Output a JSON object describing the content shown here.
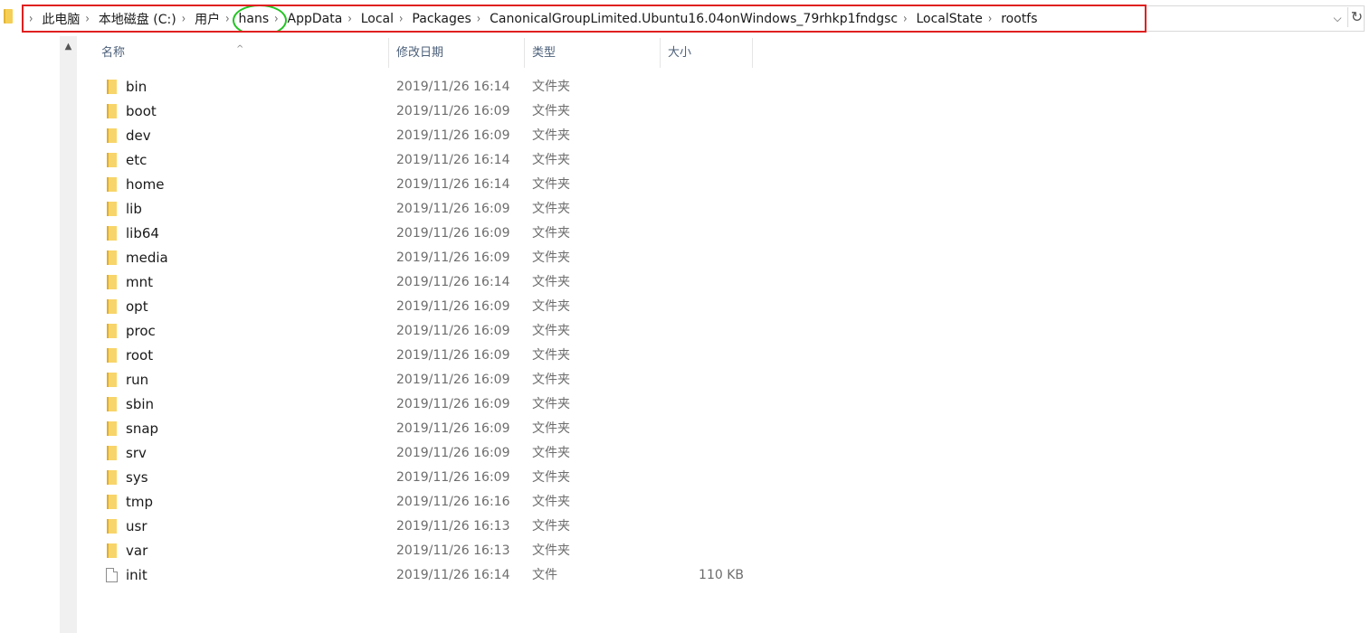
{
  "address_bar": {
    "breadcrumbs": [
      "此电脑",
      "本地磁盘 (C:)",
      "用户",
      "hans",
      "AppData",
      "Local",
      "Packages",
      "CanonicalGroupLimited.Ubuntu16.04onWindows_79rhkp1fndgsc",
      "LocalState",
      "rootfs"
    ],
    "separator_glyph": "›",
    "dropdown_glyph": "⌵",
    "refresh_glyph": "↻",
    "highlight_box_color": "#e02020",
    "highlight_ellipse_color": "#22c422"
  },
  "columns": {
    "name": "名称",
    "date": "修改日期",
    "type": "类型",
    "size": "大小"
  },
  "files": [
    {
      "name": "bin",
      "date": "2019/11/26 16:14",
      "type": "文件夹",
      "size": "",
      "icon": "folder-icon"
    },
    {
      "name": "boot",
      "date": "2019/11/26 16:09",
      "type": "文件夹",
      "size": "",
      "icon": "folder-icon"
    },
    {
      "name": "dev",
      "date": "2019/11/26 16:09",
      "type": "文件夹",
      "size": "",
      "icon": "folder-icon"
    },
    {
      "name": "etc",
      "date": "2019/11/26 16:14",
      "type": "文件夹",
      "size": "",
      "icon": "folder-icon"
    },
    {
      "name": "home",
      "date": "2019/11/26 16:14",
      "type": "文件夹",
      "size": "",
      "icon": "folder-icon"
    },
    {
      "name": "lib",
      "date": "2019/11/26 16:09",
      "type": "文件夹",
      "size": "",
      "icon": "folder-icon"
    },
    {
      "name": "lib64",
      "date": "2019/11/26 16:09",
      "type": "文件夹",
      "size": "",
      "icon": "folder-icon"
    },
    {
      "name": "media",
      "date": "2019/11/26 16:09",
      "type": "文件夹",
      "size": "",
      "icon": "folder-icon"
    },
    {
      "name": "mnt",
      "date": "2019/11/26 16:14",
      "type": "文件夹",
      "size": "",
      "icon": "folder-icon"
    },
    {
      "name": "opt",
      "date": "2019/11/26 16:09",
      "type": "文件夹",
      "size": "",
      "icon": "folder-icon"
    },
    {
      "name": "proc",
      "date": "2019/11/26 16:09",
      "type": "文件夹",
      "size": "",
      "icon": "folder-icon"
    },
    {
      "name": "root",
      "date": "2019/11/26 16:09",
      "type": "文件夹",
      "size": "",
      "icon": "folder-icon"
    },
    {
      "name": "run",
      "date": "2019/11/26 16:09",
      "type": "文件夹",
      "size": "",
      "icon": "folder-icon"
    },
    {
      "name": "sbin",
      "date": "2019/11/26 16:09",
      "type": "文件夹",
      "size": "",
      "icon": "folder-icon"
    },
    {
      "name": "snap",
      "date": "2019/11/26 16:09",
      "type": "文件夹",
      "size": "",
      "icon": "folder-icon"
    },
    {
      "name": "srv",
      "date": "2019/11/26 16:09",
      "type": "文件夹",
      "size": "",
      "icon": "folder-icon"
    },
    {
      "name": "sys",
      "date": "2019/11/26 16:09",
      "type": "文件夹",
      "size": "",
      "icon": "folder-icon"
    },
    {
      "name": "tmp",
      "date": "2019/11/26 16:16",
      "type": "文件夹",
      "size": "",
      "icon": "folder-icon"
    },
    {
      "name": "usr",
      "date": "2019/11/26 16:13",
      "type": "文件夹",
      "size": "",
      "icon": "folder-icon"
    },
    {
      "name": "var",
      "date": "2019/11/26 16:13",
      "type": "文件夹",
      "size": "",
      "icon": "folder-icon"
    },
    {
      "name": "init",
      "date": "2019/11/26 16:14",
      "type": "文件",
      "size": "110 KB",
      "icon": "file-icon"
    }
  ]
}
